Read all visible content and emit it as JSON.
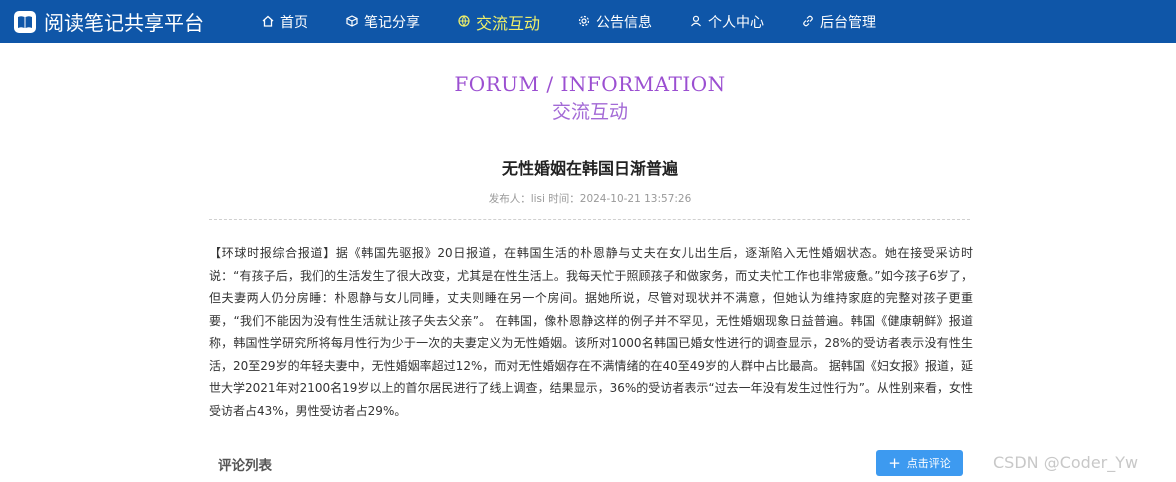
{
  "site": {
    "title": "阅读笔记共享平台",
    "logo_icon": "book-icon"
  },
  "nav": {
    "items": [
      {
        "label": "首页",
        "icon": "home-icon"
      },
      {
        "label": "笔记分享",
        "icon": "cube-icon"
      },
      {
        "label": "交流互动",
        "icon": "globe-icon",
        "active": true
      },
      {
        "label": "公告信息",
        "icon": "gear-icon"
      },
      {
        "label": "个人中心",
        "icon": "user-icon"
      },
      {
        "label": "后台管理",
        "icon": "link-icon"
      }
    ]
  },
  "section": {
    "title_en": "FORUM / INFORMATION",
    "title_cn": "交流互动"
  },
  "article": {
    "title": "无性婚姻在韩国日渐普遍",
    "meta": "发布人：lisi 时间：2024-10-21 13:57:26",
    "content": "【环球时报综合报道】据《韩国先驱报》20日报道，在韩国生活的朴恩静与丈夫在女儿出生后，逐渐陷入无性婚姻状态。她在接受采访时说：“有孩子后，我们的生活发生了很大改变，尤其是在性生活上。我每天忙于照顾孩子和做家务，而丈夫忙工作也非常疲惫。”如今孩子6岁了，但夫妻两人仍分房睡：朴恩静与女儿同睡，丈夫则睡在另一个房间。据她所说，尽管对现状并不满意，但她认为维持家庭的完整对孩子更重要，“我们不能因为没有性生活就让孩子失去父亲”。 在韩国，像朴恩静这样的例子并不罕见，无性婚姻现象日益普遍。韩国《健康朝鲜》报道称，韩国性学研究所将每月性行为少于一次的夫妻定义为无性婚姻。该所对1000名韩国已婚女性进行的调查显示，28%的受访者表示没有性生活，20至29岁的年轻夫妻中，无性婚姻率超过12%，而对无性婚姻存在不满情绪的在40至49岁的人群中占比最高。 据韩国《妇女报》报道，延世大学2021年对2100名19岁以上的首尔居民进行了线上调查，结果显示，36%的受访者表示“过去一年没有发生过性行为”。从性别来看，女性受访者占43%，男性受访者占29%。"
  },
  "comments": {
    "title": "评论列表",
    "add_button": "点击评论"
  },
  "watermark": "CSDN @Coder_Yw",
  "colors": {
    "header_bg": "#0f56a8",
    "active_nav": "#f0f06a",
    "accent_purple": "#9b4fd1",
    "button_blue": "#3d9af0"
  }
}
